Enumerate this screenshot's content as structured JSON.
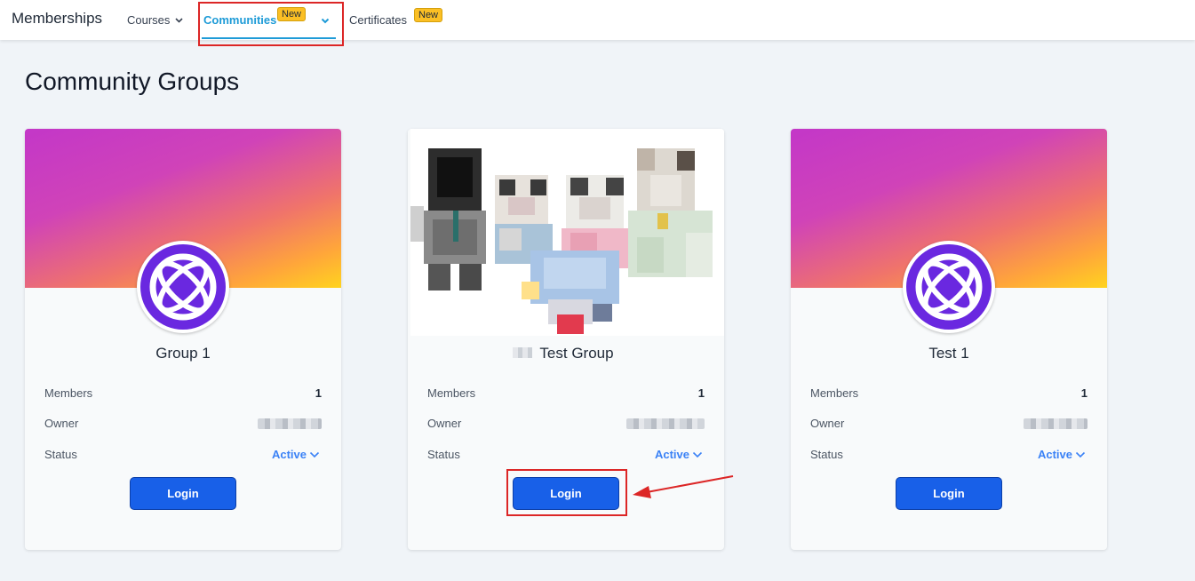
{
  "topnav": {
    "brand": "Memberships",
    "items": [
      {
        "label": "Courses"
      },
      {
        "label": "Communities",
        "badge": "New",
        "active": true
      },
      {
        "label": "Certificates",
        "badge": "New"
      }
    ]
  },
  "page": {
    "title": "Community Groups"
  },
  "labels": {
    "members": "Members",
    "owner": "Owner",
    "status": "Status"
  },
  "groups": [
    {
      "name": "Group 1",
      "members": "1",
      "status": "Active",
      "login_label": "Login"
    },
    {
      "name": "Test Group",
      "members": "1",
      "status": "Active",
      "login_label": "Login"
    },
    {
      "name": "Test 1",
      "members": "1",
      "status": "Active",
      "login_label": "Login"
    }
  ],
  "colors": {
    "accent": "#1e9bd7",
    "button": "#1860e8",
    "status": "#3b82f6",
    "badge": "#fbbf24",
    "highlight": "#dc2626",
    "avatar": "#6a28e0"
  },
  "icons": {
    "avatar": "circle-globe-logo-icon",
    "dropdown": "chevron-down-icon"
  }
}
